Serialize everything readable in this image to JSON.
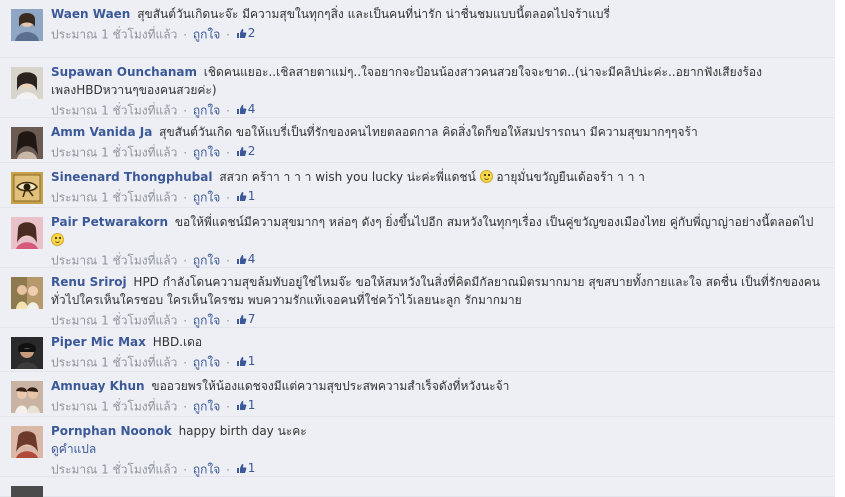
{
  "labels": {
    "like": "ถูกใจ",
    "see_translation": "ดูคำแปล",
    "dot": "·"
  },
  "colors": {
    "link": "#3b5998",
    "meta": "#90949c",
    "panel": "#edeff4"
  },
  "comments": [
    {
      "name": "Waen Waen",
      "text": "สุขสันต์วันเกิดนะจ๊ะ มีความสุขในทุกๆสิ่ง และเป็นคนที่น่ารัก น่าชื่นชมแบบนี้ตลอดไปจร้าแบรี่",
      "time": "ประมาณ 1 ชั่วโมงที่แล้ว",
      "likes": "2"
    },
    {
      "name": "Supawan Ounchanam",
      "text": "เชิดคนแยอะ..เชิลสายตาแม่ๆ..ใจอยากจะป้อนน้องสาวคนสวยใจจะขาด..(น่าจะมีคลิปน่ะค่ะ..อยากฟังเสียงร้องเพลงHBDหวานๆของคนสวยค่ะ)",
      "time": "ประมาณ 1 ชั่วโมงที่แล้ว",
      "likes": "4"
    },
    {
      "name": "Amm Vanida Ja",
      "text": "สุขสันต์วันเกิด ขอให้แบรี่เป็นที่รักของคนไทยตลอดกาล คิดสิ่งใดก็ขอให้สมปรารถนา มีความสุขมากๆๆจร้า",
      "time": "ประมาณ 1 ชั่วโมงที่แล้ว",
      "likes": "2"
    },
    {
      "name": "Sineenard Thongphubal",
      "text": "สสวก คร้าา า า า wish you lucky น่ะค่ะพี่แดชน์",
      "text_after": "อายุมั่นขวัญยืนเด้อจร้า า า า",
      "time": "ประมาณ 1 ชั่วโมงที่แล้ว",
      "likes": "1"
    },
    {
      "name": "Pair Petwarakorn",
      "text": "ขอให้พี่แดชน์มีความสุขมากๆ หล่อๆ ดังๆ ยิ่งขึ้นไปอีก สมหวังในทุกๆเรื่อง เป็นคู่ขวัญของเมืองไทย คู่กับพี่ญาญ่าอย่างนี้ตลอดไป",
      "time": "ประมาณ 1 ชั่วโมงที่แล้ว",
      "likes": "4"
    },
    {
      "name": "Renu Sriroj",
      "text": "HPD กำลังโดนความสุขล้มทับอยู่ใช่ไหมจ๊ะ ขอให้สมหวังในสิ่งที่คิดมีกัลยาณมิตรมากมาย สุขสบายทั้งกายและใจ สดชื่น เป็นที่รักของคนทั่วไปใครเห็นใครชอบ ใครเห็นใครชม พบความรักแท้เจอคนที่ใช่คว้าไว้เลยนะลูก รักมากมาย",
      "time": "ประมาณ 1 ชั่วโมงที่แล้ว",
      "likes": "7"
    },
    {
      "name": "Piper Mic Max",
      "text": "HBD.เดอ",
      "time": "ประมาณ 1 ชั่วโมงที่แล้ว",
      "likes": "1"
    },
    {
      "name": "Amnuay Khun",
      "text": "ขออวยพรให้น้องแดชจงมีแต่ความสุขประสพความสำเร็จดังที่หวังนะจ้า",
      "time": "ประมาณ 1 ชั่วโมงที่แล้ว",
      "likes": "1"
    },
    {
      "name": "Pornphan Noonok",
      "text": "happy birth day นะคะ",
      "time": "ประมาณ 1 ชั่วโมงที่แล้ว",
      "likes": "1"
    }
  ]
}
